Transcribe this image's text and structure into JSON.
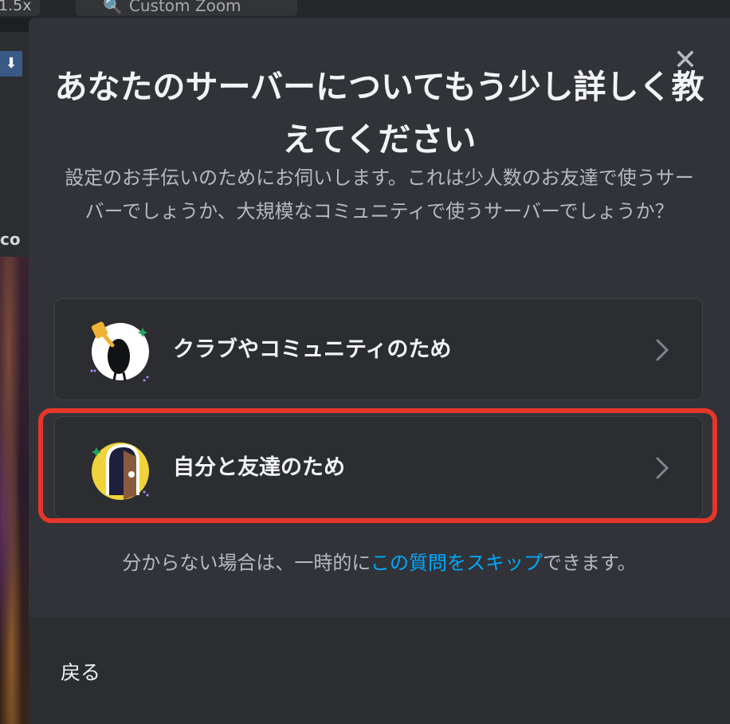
{
  "background": {
    "zoom_label": "1.5x",
    "custom_zoom_label": "Custom Zoom",
    "sidebar_snippet": "co"
  },
  "modal": {
    "title": "あなたのサーバーについてもう少し詳しく教えてください",
    "subtitle": "設定のお手伝いのためにお伺いします。これは少人数のお友達で使うサーバーでしょうか、大規模なコミュニティで使うサーバーでしょうか？",
    "options": [
      {
        "label": "クラブやコミュニティのため",
        "icon": "club-community-icon"
      },
      {
        "label": "自分と友達のため",
        "icon": "friends-door-icon"
      }
    ],
    "skip_prefix": "分からない場合は、一時的に",
    "skip_link": "この質問をスキップ",
    "skip_suffix": "できます。",
    "back_label": "戻る"
  },
  "colors": {
    "modal_bg": "#313338",
    "card_bg": "#2b2d31",
    "link": "#00a8fc",
    "highlight": "#e4362a"
  }
}
